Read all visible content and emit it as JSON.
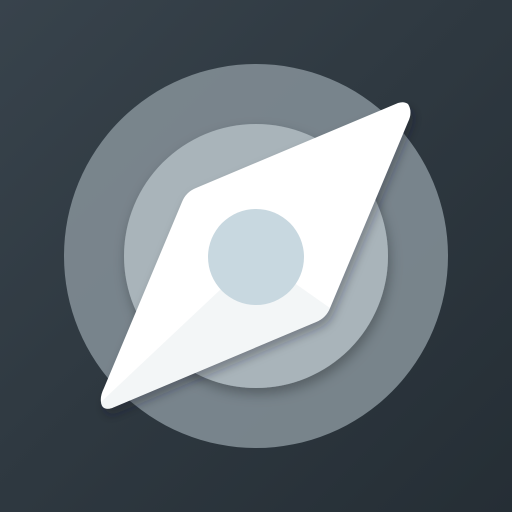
{
  "app_icon": {
    "name": "compass-app-icon",
    "background_color": "#2c353d",
    "outer_ring_color": "#7f8b93",
    "inner_disc_color": "#a9b4ba",
    "needle_color": "#ffffff",
    "center_dot_color": "#c8d8e0"
  }
}
